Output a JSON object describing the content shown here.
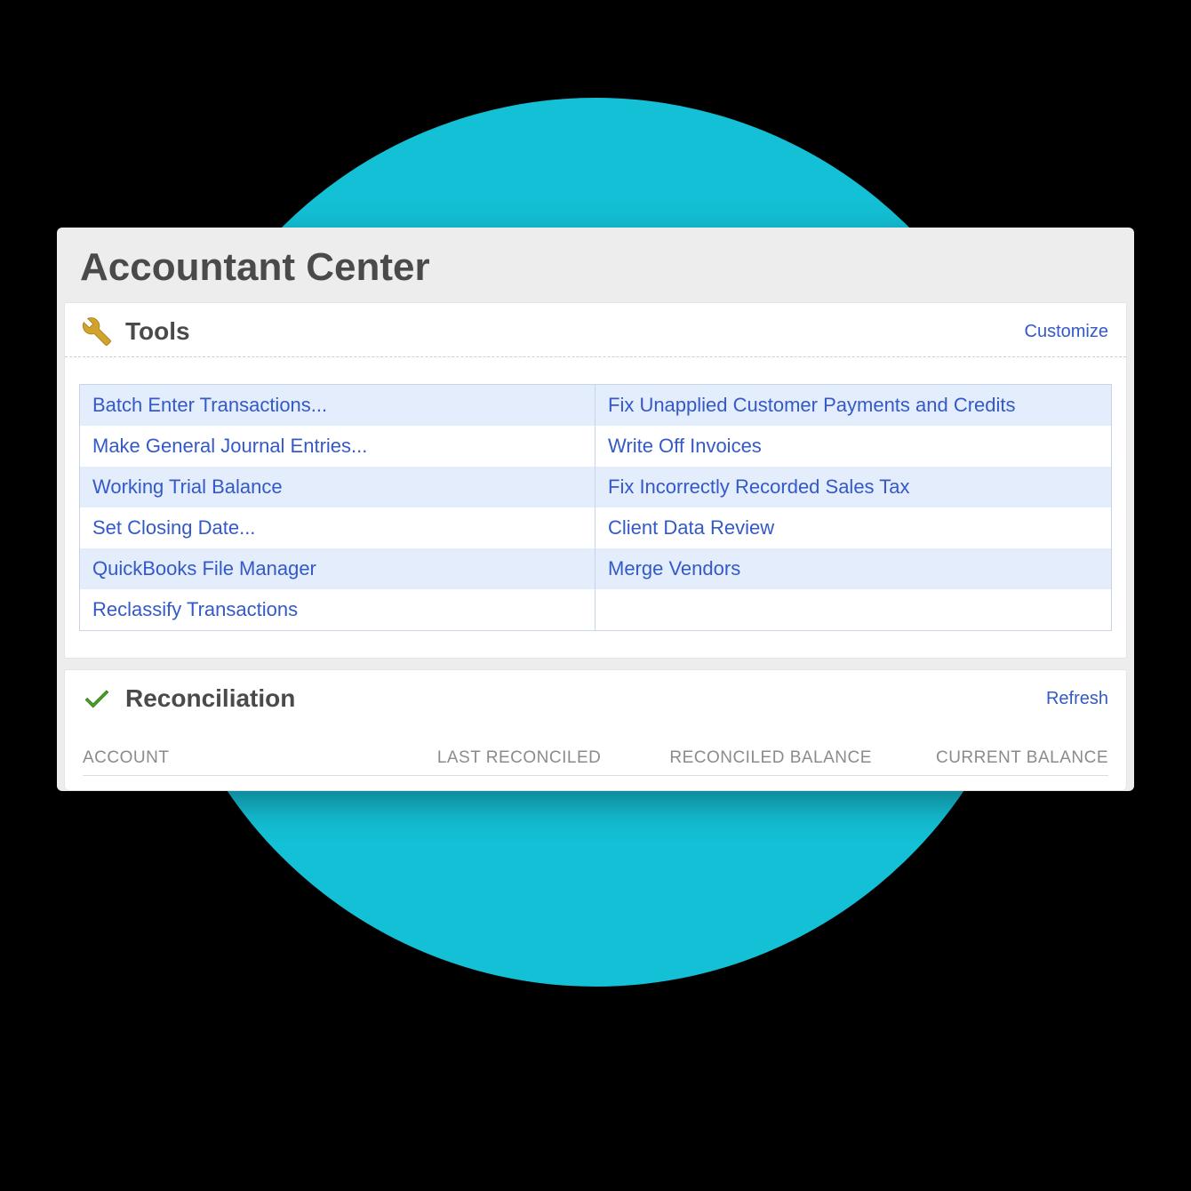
{
  "window": {
    "title": "Accountant Center"
  },
  "tools": {
    "title": "Tools",
    "customize": "Customize",
    "left": [
      "Batch Enter Transactions...",
      "Make General Journal Entries...",
      "Working Trial Balance",
      "Set Closing Date...",
      "QuickBooks File Manager",
      "Reclassify Transactions"
    ],
    "right": [
      "Fix Unapplied Customer Payments and Credits",
      "Write Off Invoices",
      "Fix Incorrectly Recorded Sales Tax",
      "Client Data Review",
      "Merge Vendors",
      ""
    ]
  },
  "reconciliation": {
    "title": "Reconciliation",
    "refresh": "Refresh",
    "columns": {
      "account": "ACCOUNT",
      "last_reconciled": "LAST RECONCILED",
      "reconciled_balance": "RECONCILED BALANCE",
      "current_balance": "CURRENT BALANCE"
    }
  }
}
